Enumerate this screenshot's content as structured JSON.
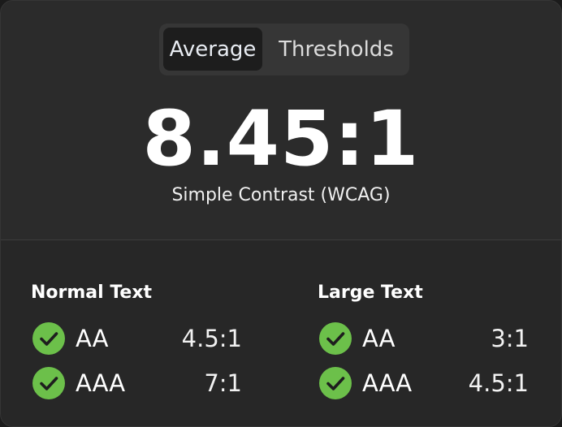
{
  "tabs": {
    "average": "Average",
    "thresholds": "Thresholds"
  },
  "ratio": "8.45:1",
  "subtitle": "Simple Contrast (WCAG)",
  "normal": {
    "title": "Normal Text",
    "rows": [
      {
        "level": "AA",
        "threshold": "4.5:1",
        "status_icon": "check-circle-icon"
      },
      {
        "level": "AAA",
        "threshold": "7:1",
        "status_icon": "check-circle-icon"
      }
    ]
  },
  "large": {
    "title": "Large Text",
    "rows": [
      {
        "level": "AA",
        "threshold": "3:1",
        "status_icon": "check-circle-icon"
      },
      {
        "level": "AAA",
        "threshold": "4.5:1",
        "status_icon": "check-circle-icon"
      }
    ]
  },
  "colors": {
    "pass": "#6cc04a",
    "background": "#2b2b2b"
  }
}
